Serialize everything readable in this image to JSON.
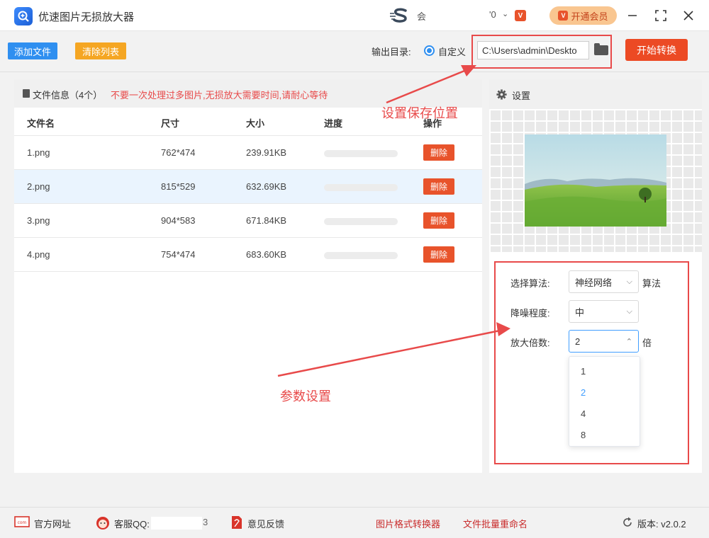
{
  "app": {
    "title": "优速图片无损放大器",
    "member_text": "会",
    "user_tail": "'0",
    "vip_label": "开通会员"
  },
  "toolbar": {
    "add_label": "添加文件",
    "clear_label": "清除列表",
    "output_label": "输出目录:",
    "radio_label": "自定义",
    "output_path": "C:\\Users\\admin\\Deskto",
    "start_label": "开始转换"
  },
  "file_panel": {
    "title": "文件信息（4个）",
    "warning": "不要一次处理过多图片,无损放大需要时间,请耐心等待",
    "columns": [
      "文件名",
      "尺寸",
      "大小",
      "进度",
      "操作"
    ],
    "rows": [
      {
        "name": "1.png",
        "size": "762*474",
        "filesize": "239.91KB",
        "progress": 0,
        "action": "删除"
      },
      {
        "name": "2.png",
        "size": "815*529",
        "filesize": "632.69KB",
        "progress": 0,
        "action": "删除"
      },
      {
        "name": "3.png",
        "size": "904*583",
        "filesize": "671.84KB",
        "progress": 0,
        "action": "删除"
      },
      {
        "name": "4.png",
        "size": "754*474",
        "filesize": "683.60KB",
        "progress": 0,
        "action": "删除"
      }
    ]
  },
  "settings": {
    "title": "设置",
    "algorithm_label": "选择算法:",
    "algorithm_value": "神经网络",
    "algorithm_suffix": "算法",
    "denoise_label": "降噪程度:",
    "denoise_value": "中",
    "scale_label": "放大倍数:",
    "scale_value": "2",
    "scale_suffix": "倍",
    "scale_options": [
      "1",
      "2",
      "4",
      "8"
    ]
  },
  "annotations": {
    "save_location": "设置保存位置",
    "params": "参数设置"
  },
  "footer": {
    "website": "官方网址",
    "qq": "客服QQ:",
    "qq_tail": "3",
    "feedback": "意见反馈",
    "format_converter": "图片格式转换器",
    "batch_rename": "文件批量重命名",
    "version": "版本: v2.0.2"
  },
  "colors": {
    "primary_blue": "#2f8ff0",
    "orange": "#f5a623",
    "red": "#ec4a24",
    "annotation_red": "#e84a4a"
  }
}
